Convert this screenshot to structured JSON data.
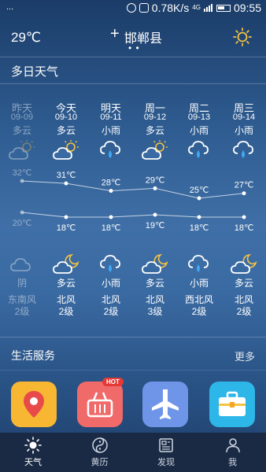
{
  "status_bar": {
    "left_text": "...",
    "speed": "0.78K/s",
    "network": "4G",
    "time": "09:55"
  },
  "header": {
    "current_temp": "29℃",
    "add_symbol": "+",
    "city": "邯郸县",
    "page_dots": "• •"
  },
  "forecast": {
    "title": "多日天气",
    "days": [
      {
        "day": "昨天",
        "date": "09-09",
        "day_cond": "多云",
        "day_icon": "partly-cloudy-sun-icon",
        "high": "32℃",
        "low": "20℃",
        "night_icon": "cloud-icon",
        "night_cond": "阴",
        "wind_dir": "东南风",
        "wind_level": "2级",
        "past": true
      },
      {
        "day": "今天",
        "date": "09-10",
        "day_cond": "多云",
        "day_icon": "partly-cloudy-sun-icon",
        "high": "31℃",
        "low": "18℃",
        "night_icon": "partly-cloudy-moon-icon",
        "night_cond": "多云",
        "wind_dir": "北风",
        "wind_level": "2级",
        "past": false
      },
      {
        "day": "明天",
        "date": "09-11",
        "day_cond": "小雨",
        "day_icon": "rain-cloud-icon",
        "high": "28℃",
        "low": "18℃",
        "night_icon": "rain-cloud-icon",
        "night_cond": "小雨",
        "wind_dir": "北风",
        "wind_level": "2级",
        "past": false
      },
      {
        "day": "周一",
        "date": "09-12",
        "day_cond": "多云",
        "day_icon": "partly-cloudy-sun-icon",
        "high": "29℃",
        "low": "19℃",
        "night_icon": "partly-cloudy-moon-icon",
        "night_cond": "多云",
        "wind_dir": "北风",
        "wind_level": "3级",
        "past": false
      },
      {
        "day": "周二",
        "date": "09-13",
        "day_cond": "小雨",
        "day_icon": "rain-cloud-icon",
        "high": "25℃",
        "low": "18℃",
        "night_icon": "rain-cloud-icon",
        "night_cond": "小雨",
        "wind_dir": "西北风",
        "wind_level": "2级",
        "past": false
      },
      {
        "day": "周三",
        "date": "09-14",
        "day_cond": "小雨",
        "day_icon": "rain-cloud-icon",
        "high": "27℃",
        "low": "18℃",
        "night_icon": "partly-cloudy-moon-icon",
        "night_cond": "多云",
        "wind_dir": "北风",
        "wind_level": "2级",
        "past": false
      }
    ]
  },
  "services": {
    "title": "生活服务",
    "more": "更多",
    "apps": [
      {
        "icon": "location-pin-icon",
        "color": "#f7b733"
      },
      {
        "icon": "shopping-basket-icon",
        "color": "#f06a6a",
        "badge": "HOT"
      },
      {
        "icon": "airplane-icon",
        "color": "#6f95e8"
      },
      {
        "icon": "briefcase-icon",
        "color": "#2db6e8"
      }
    ]
  },
  "tabbar": {
    "tabs": [
      {
        "label": "天气",
        "icon": "sun-icon",
        "active": true
      },
      {
        "label": "黄历",
        "icon": "yin-yang-icon",
        "active": false
      },
      {
        "label": "发现",
        "icon": "news-icon",
        "active": false
      },
      {
        "label": "我",
        "icon": "person-icon",
        "active": false
      }
    ]
  },
  "colors": {
    "accent_yellow": "#f5c242",
    "rain_drop": "#3fa9f5",
    "tabbar_bg": "#1b2a44"
  }
}
